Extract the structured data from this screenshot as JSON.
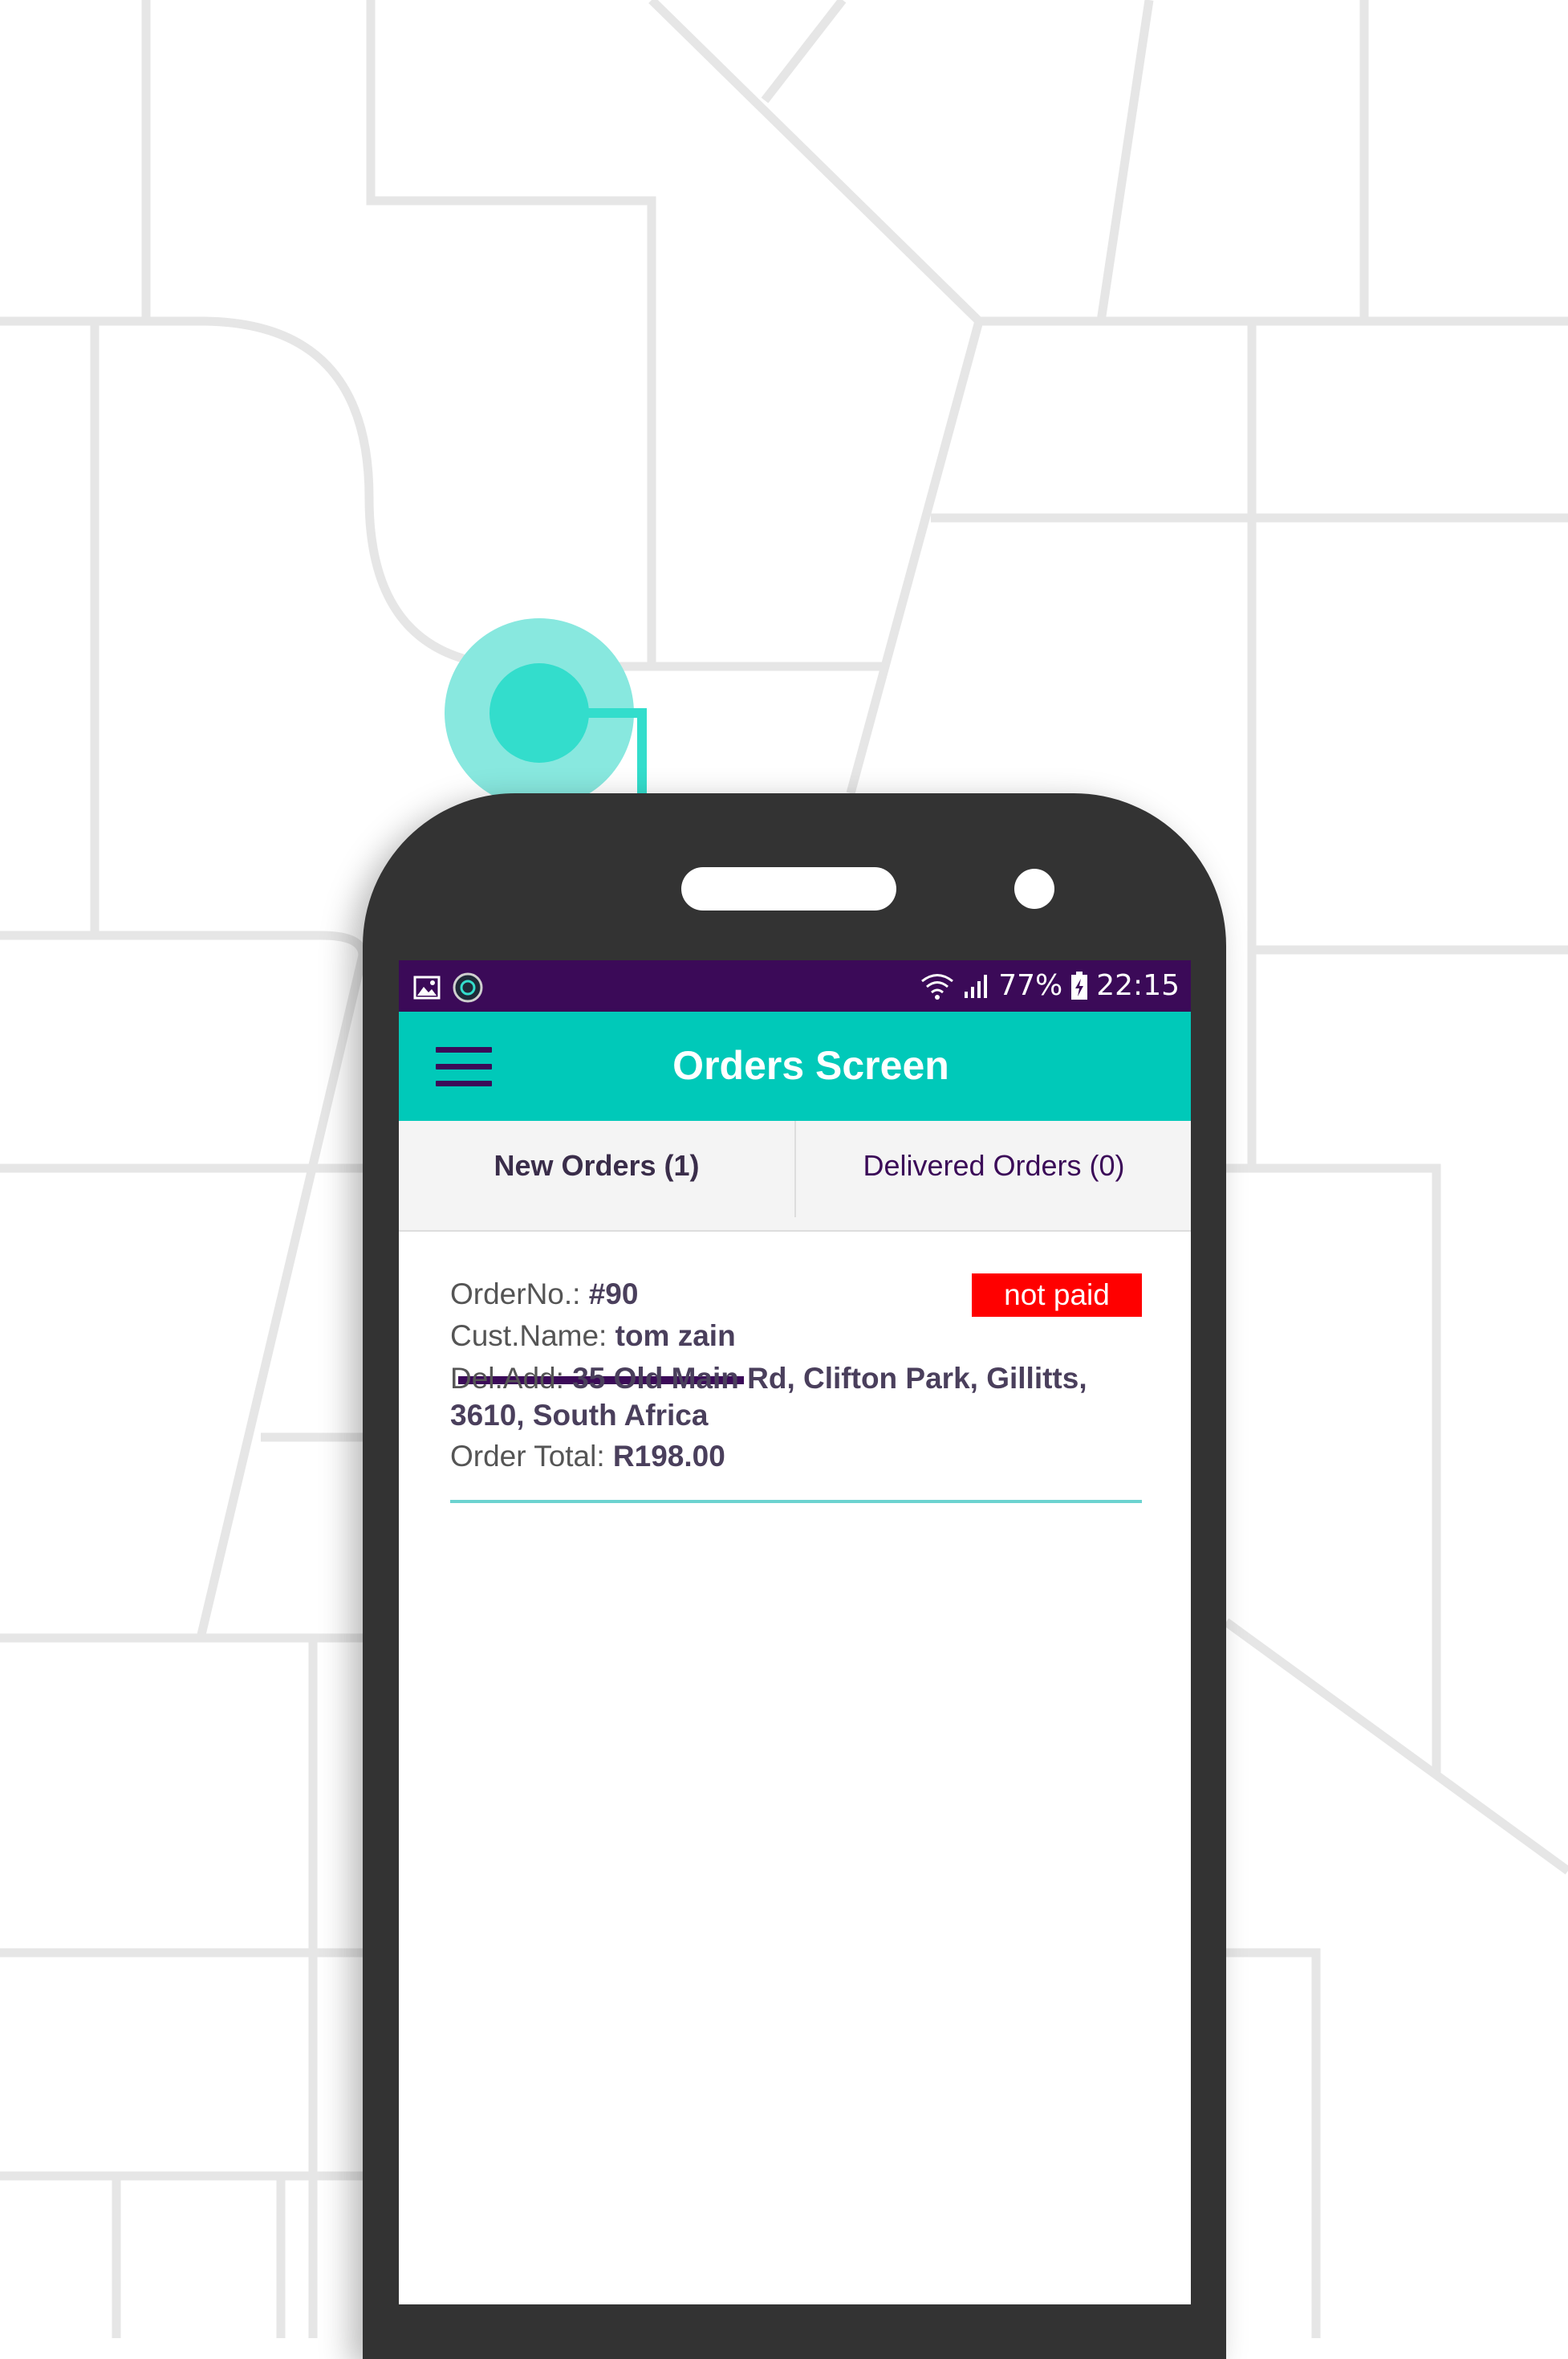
{
  "status_bar": {
    "battery": "77%",
    "time": "22:15",
    "left_icons": [
      "image-icon",
      "app-notification-icon"
    ],
    "right_icons": [
      "wifi-icon",
      "signal-icon",
      "battery-icon"
    ]
  },
  "app_bar": {
    "title": "Orders Screen",
    "menu_icon": "hamburger-menu-icon"
  },
  "tabs": [
    {
      "label": "New Orders (1)",
      "active": true
    },
    {
      "label": "Delivered Orders (0)",
      "active": false
    }
  ],
  "orders": [
    {
      "order_no_label": "OrderNo.: ",
      "order_no": "#90",
      "customer_label": "Cust.Name: ",
      "customer": "tom zain",
      "address_label": "Del.Add: ",
      "address": "35 Old Main Rd, Clifton Park, Gillitts, 3610, South Africa",
      "total_label": "Order Total: ",
      "total": "R198.00",
      "payment_status": "not paid"
    }
  ],
  "colors": {
    "status_bar": "#3b0a58",
    "app_bar": "#00c9b9",
    "accent_purple": "#3b0a58",
    "badge_red": "#ff0000",
    "divider_teal": "#6cd3d0",
    "map_lines": "#e6e6e6",
    "location_marker": "#33ddcc"
  }
}
